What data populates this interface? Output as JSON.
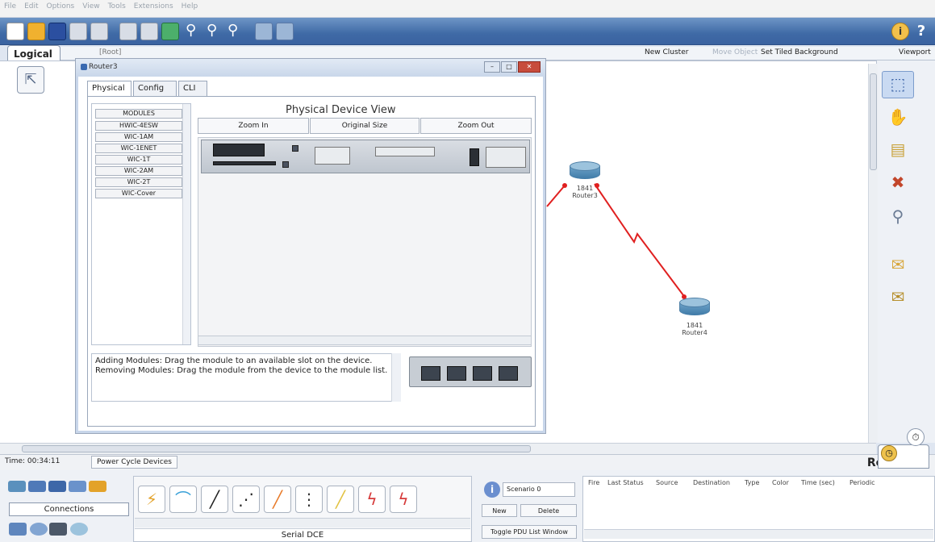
{
  "menubar": {
    "items": [
      "File",
      "Edit",
      "Options",
      "View",
      "Tools",
      "Extensions",
      "Help"
    ]
  },
  "header": {
    "logical_tab": "Logical",
    "root_label": "[Root]",
    "new_cluster": "New Cluster",
    "move_object": "Move Object",
    "set_tiled_background": "Set Tiled Background",
    "viewport": "Viewport"
  },
  "dialog": {
    "title": "Router3",
    "tabs": [
      "Physical",
      "Config",
      "CLI"
    ],
    "modules_header": "MODULES",
    "modules": [
      "HWIC-4ESW",
      "WIC-1AM",
      "WIC-1ENET",
      "WIC-1T",
      "WIC-2AM",
      "WIC-2T",
      "WIC-Cover"
    ],
    "view_title": "Physical Device View",
    "zoom_in": "Zoom In",
    "original_size": "Original Size",
    "zoom_out": "Zoom Out",
    "info_text": "Adding Modules: Drag the module to an available slot on the device.\nRemoving Modules: Drag the module from the device to the module list."
  },
  "devices": [
    {
      "model": "1841",
      "name": "Router3"
    },
    {
      "model": "1841",
      "name": "Router4"
    }
  ],
  "status": {
    "time": "Time: 00:34:11",
    "power_cycle": "Power Cycle Devices",
    "mode": "Realtime"
  },
  "bottom": {
    "connections_label": "Connections",
    "cable_label": "Serial DCE",
    "scenario": "Scenario 0",
    "new": "New",
    "delete": "Delete",
    "toggle": "Toggle PDU List Window",
    "pdu_columns": [
      "Fire",
      "Last Status",
      "Source",
      "Destination",
      "Type",
      "Color",
      "Time (sec)",
      "Periodic"
    ]
  },
  "colors": {
    "accent": "#3f6aa6",
    "link": "#e02020",
    "router": "#5a90bd"
  }
}
